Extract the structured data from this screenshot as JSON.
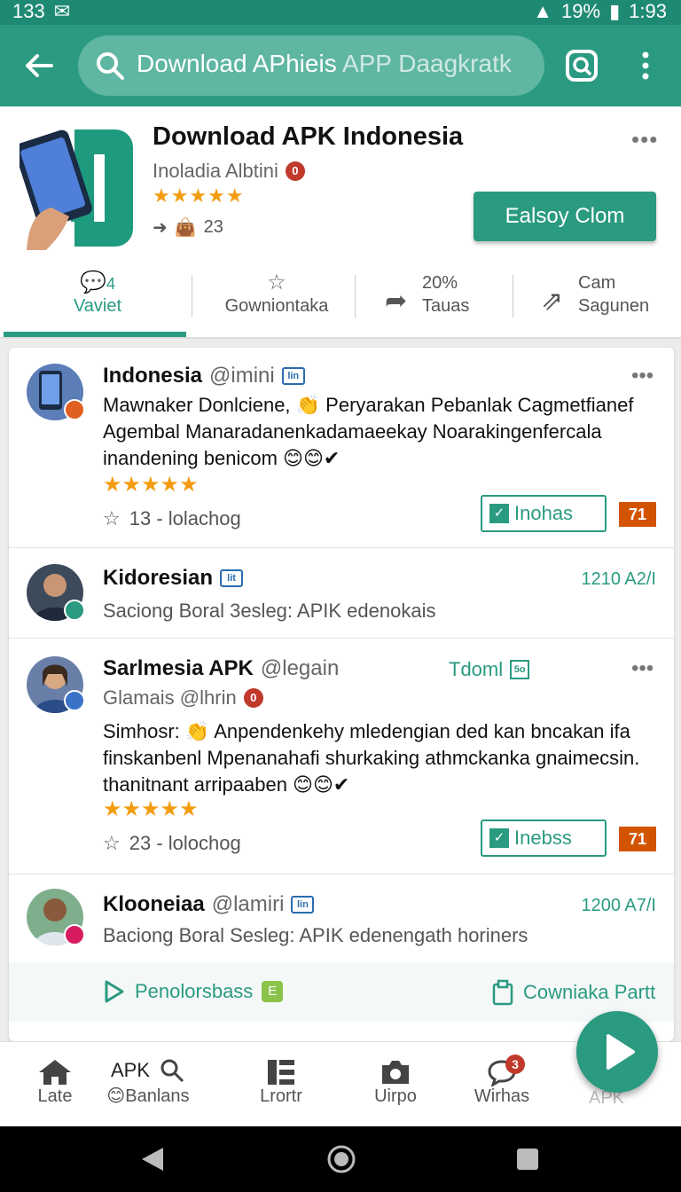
{
  "status_bar": {
    "left_time": "133",
    "battery": "19%",
    "clock": "1:93"
  },
  "search": {
    "main": "Download APhieis ",
    "faint": "APP Daagkratk"
  },
  "app": {
    "title": "Download APK Indonesia",
    "developer": "Inoladia Albtini",
    "dev_badge": "0",
    "stars": "★★★★★",
    "meta_count": "23",
    "install_label": "Ealsoy Clom",
    "more": "•••"
  },
  "tabs": [
    {
      "top": "4",
      "label": "Vaviet"
    },
    {
      "top": "",
      "label": "Gowniontaka"
    },
    {
      "top": "20%",
      "label": "Tauas"
    },
    {
      "top": "Cam",
      "label": "Sagunen"
    }
  ],
  "posts": [
    {
      "name": "Indonesia",
      "handle": "@imini",
      "body": "Mawnaker Donlciene, 👏 Peryarakan Pebanlak Cagmetfianef Agembal Manaradanenkadamaeekay Noarakingenfercala inandening benicom 😊😊✔",
      "stars": "★★★★★",
      "meta": "13 - lolachog",
      "chip": "Inohas",
      "count": "71",
      "more": "•••"
    },
    {
      "name": "Kidoresian",
      "time": "1210 A2/I",
      "sub": "Saciong Boral 3esleg: APIK edenokais"
    },
    {
      "name": "Sarlmesia APK",
      "handle": "@legain",
      "tag": "Tdoml",
      "tag_box": "5o",
      "second_line": "Glamais @lhrin",
      "second_badge": "0",
      "body": "Simhosr: 👏 Anpendenkehy mledengian ded kan bncakan ifa finskanbenl Mpenanahafi shurkaking athmckanka gnaimecsin. thanitnant arripaaben 😊😊✔",
      "stars": "★★★★★",
      "meta": "23 - lolochog",
      "chip": "Inebss",
      "count": "71",
      "more": "•••"
    },
    {
      "name": "Klooneiaa",
      "handle": "@lamiri",
      "time": "1200 A7/I",
      "sub": "Baciong Boral Sesleg: APIK edenengath horiners"
    }
  ],
  "actions": {
    "left": "Penolorsbass",
    "left_badge": "E",
    "right": "Cowniaka Partt"
  },
  "bottom_nav": [
    {
      "label": "Late"
    },
    {
      "top": "APK",
      "label": "Banlans"
    },
    {
      "label": "Lrortr"
    },
    {
      "label": "Uirpo"
    },
    {
      "label": "Wirhas",
      "badge": "3"
    },
    {
      "label": "APK"
    }
  ]
}
